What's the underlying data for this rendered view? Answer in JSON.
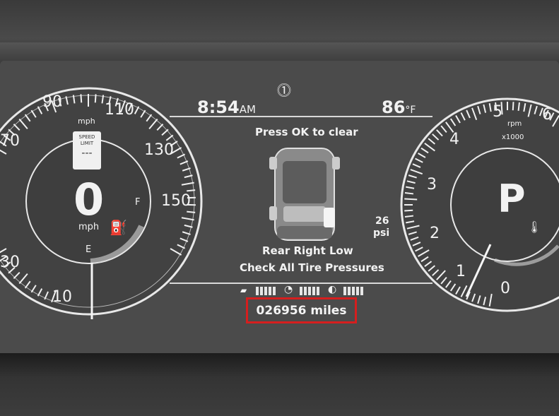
{
  "header": {
    "time": "8:54",
    "time_suffix": "AM",
    "temperature": "86",
    "temperature_unit": "°F"
  },
  "speedometer": {
    "unit_top": "mph",
    "tick_labels": [
      "70",
      "90",
      "110",
      "130",
      "150",
      "30",
      "10"
    ],
    "current_speed": "0",
    "current_unit": "mph",
    "speed_limit_sign": "SPEED LIMIT",
    "speed_limit_value": "---",
    "fuel_full": "F",
    "fuel_empty": "E"
  },
  "tachometer": {
    "unit": "rpm",
    "multiplier": "x1000",
    "tick_labels": [
      "6",
      "5",
      "4",
      "3",
      "2",
      "1",
      "0"
    ],
    "gear": "P"
  },
  "message": {
    "top": "Press OK to clear",
    "line1": "Rear Right Low",
    "line2": "Check All Tire Pressures",
    "pressure_value": "26",
    "pressure_unit": "psi"
  },
  "odometer": {
    "reading": "026956 miles"
  },
  "icons": {
    "tpms": "tire-pressure-warning-icon",
    "fuel_pump": "fuel-pump-icon",
    "coolant": "coolant-temperature-icon"
  }
}
